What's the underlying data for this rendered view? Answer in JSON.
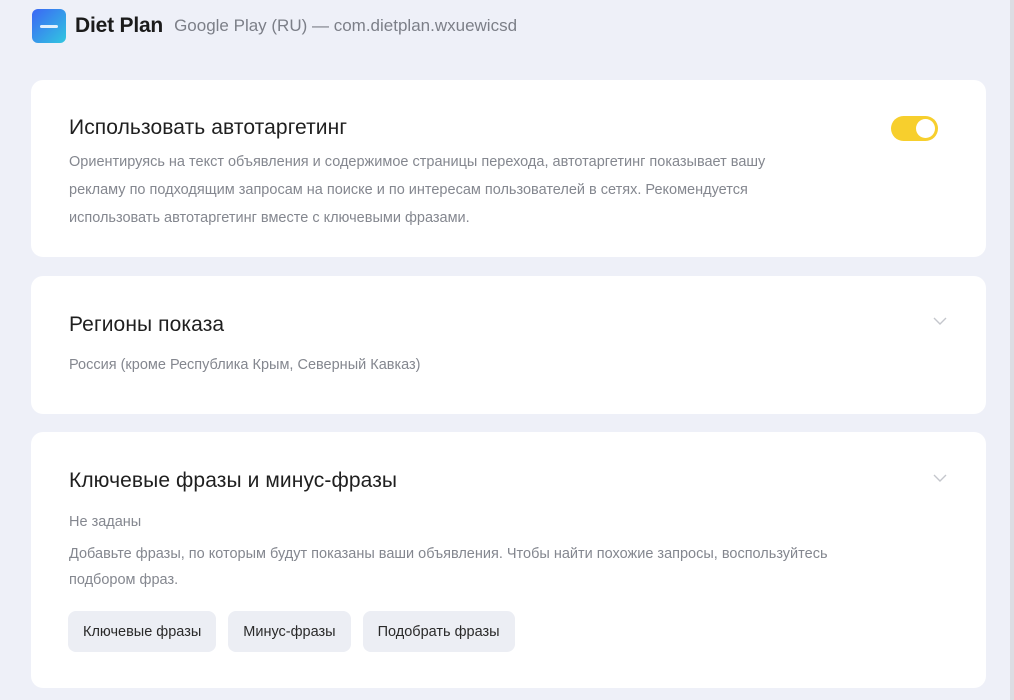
{
  "header": {
    "app_name": "Diet Plan",
    "app_sub": "Google Play (RU) — com.dietplan.wxuewicsd"
  },
  "autotargeting": {
    "title": "Использовать автотаргетинг",
    "description_lines": [
      "Ориентируясь на текст объявления и содержимое страницы перехода, автотаргетинг показывает вашу",
      "рекламу по подходящим запросам на поиске и по интересам пользователей в сетях. Рекомендуется",
      "использовать автотаргетинг вместе с ключевыми фразами."
    ],
    "toggle_on": true
  },
  "regions": {
    "title": "Регионы показа",
    "value": "Россия (кроме Республика Крым, Северный Кавказ)"
  },
  "keywords": {
    "title": "Ключевые фразы и минус-фразы",
    "status": "Не заданы",
    "hint_lines": [
      "Добавьте фразы, по которым будут показаны ваши объявления. Чтобы найти похожие запросы, воспользуйтесь",
      "подбором фраз."
    ],
    "buttons": [
      "Ключевые фразы",
      "Минус-фразы",
      "Подобрать фразы"
    ]
  },
  "colors": {
    "toggle_active": "#f7cf2d",
    "background": "#eef0f8",
    "muted_text": "#84878f"
  },
  "icons": [
    "app-logo-icon",
    "chevron-down-icon"
  ]
}
